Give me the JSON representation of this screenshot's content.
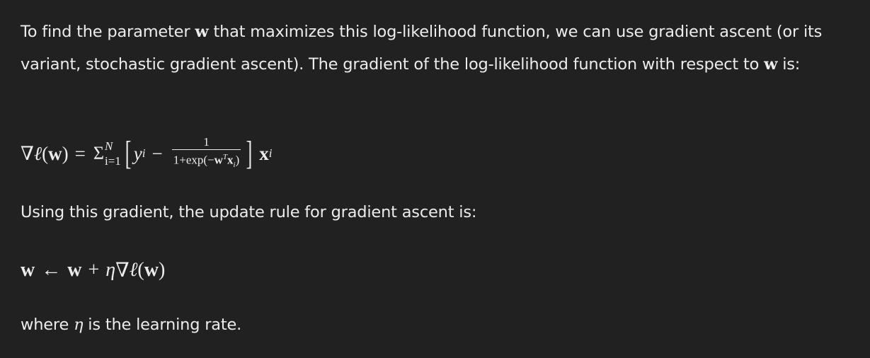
{
  "paragraph1": {
    "text_a": "To find the parameter ",
    "w": "w",
    "text_b": " that maximizes this log-likelihood function, we can use gradient ascent (or its variant, stochastic gradient ascent). The gradient of the log-likelihood function with respect to ",
    "w2": "w",
    "text_c": " is:"
  },
  "equation1": {
    "nabla": "∇",
    "ell": "ℓ",
    "lparen": "(",
    "w": "w",
    "rparen": ")",
    "equals": "=",
    "sum": "Σ",
    "sum_upper": "N",
    "sum_lower": "i=1",
    "lbracket": "[",
    "y": "y",
    "y_sub": "i",
    "minus": "−",
    "frac_num": "1",
    "frac_den_a": "1+exp(−",
    "frac_den_w": "w",
    "frac_den_T": "T",
    "frac_den_x": "x",
    "frac_den_i": "i",
    "frac_den_b": ")",
    "rbracket": "]",
    "x": "x",
    "x_sub": "i"
  },
  "paragraph2": {
    "text": "Using this gradient, the update rule for gradient ascent is:"
  },
  "equation2": {
    "w1": "w",
    "arrow": "←",
    "w2": "w",
    "plus": "+",
    "eta": "η",
    "nabla": "∇",
    "ell": "ℓ",
    "lparen": "(",
    "w3": "w",
    "rparen": ")"
  },
  "paragraph3": {
    "text_a": "where ",
    "eta": "η",
    "text_b": " is the learning rate."
  }
}
